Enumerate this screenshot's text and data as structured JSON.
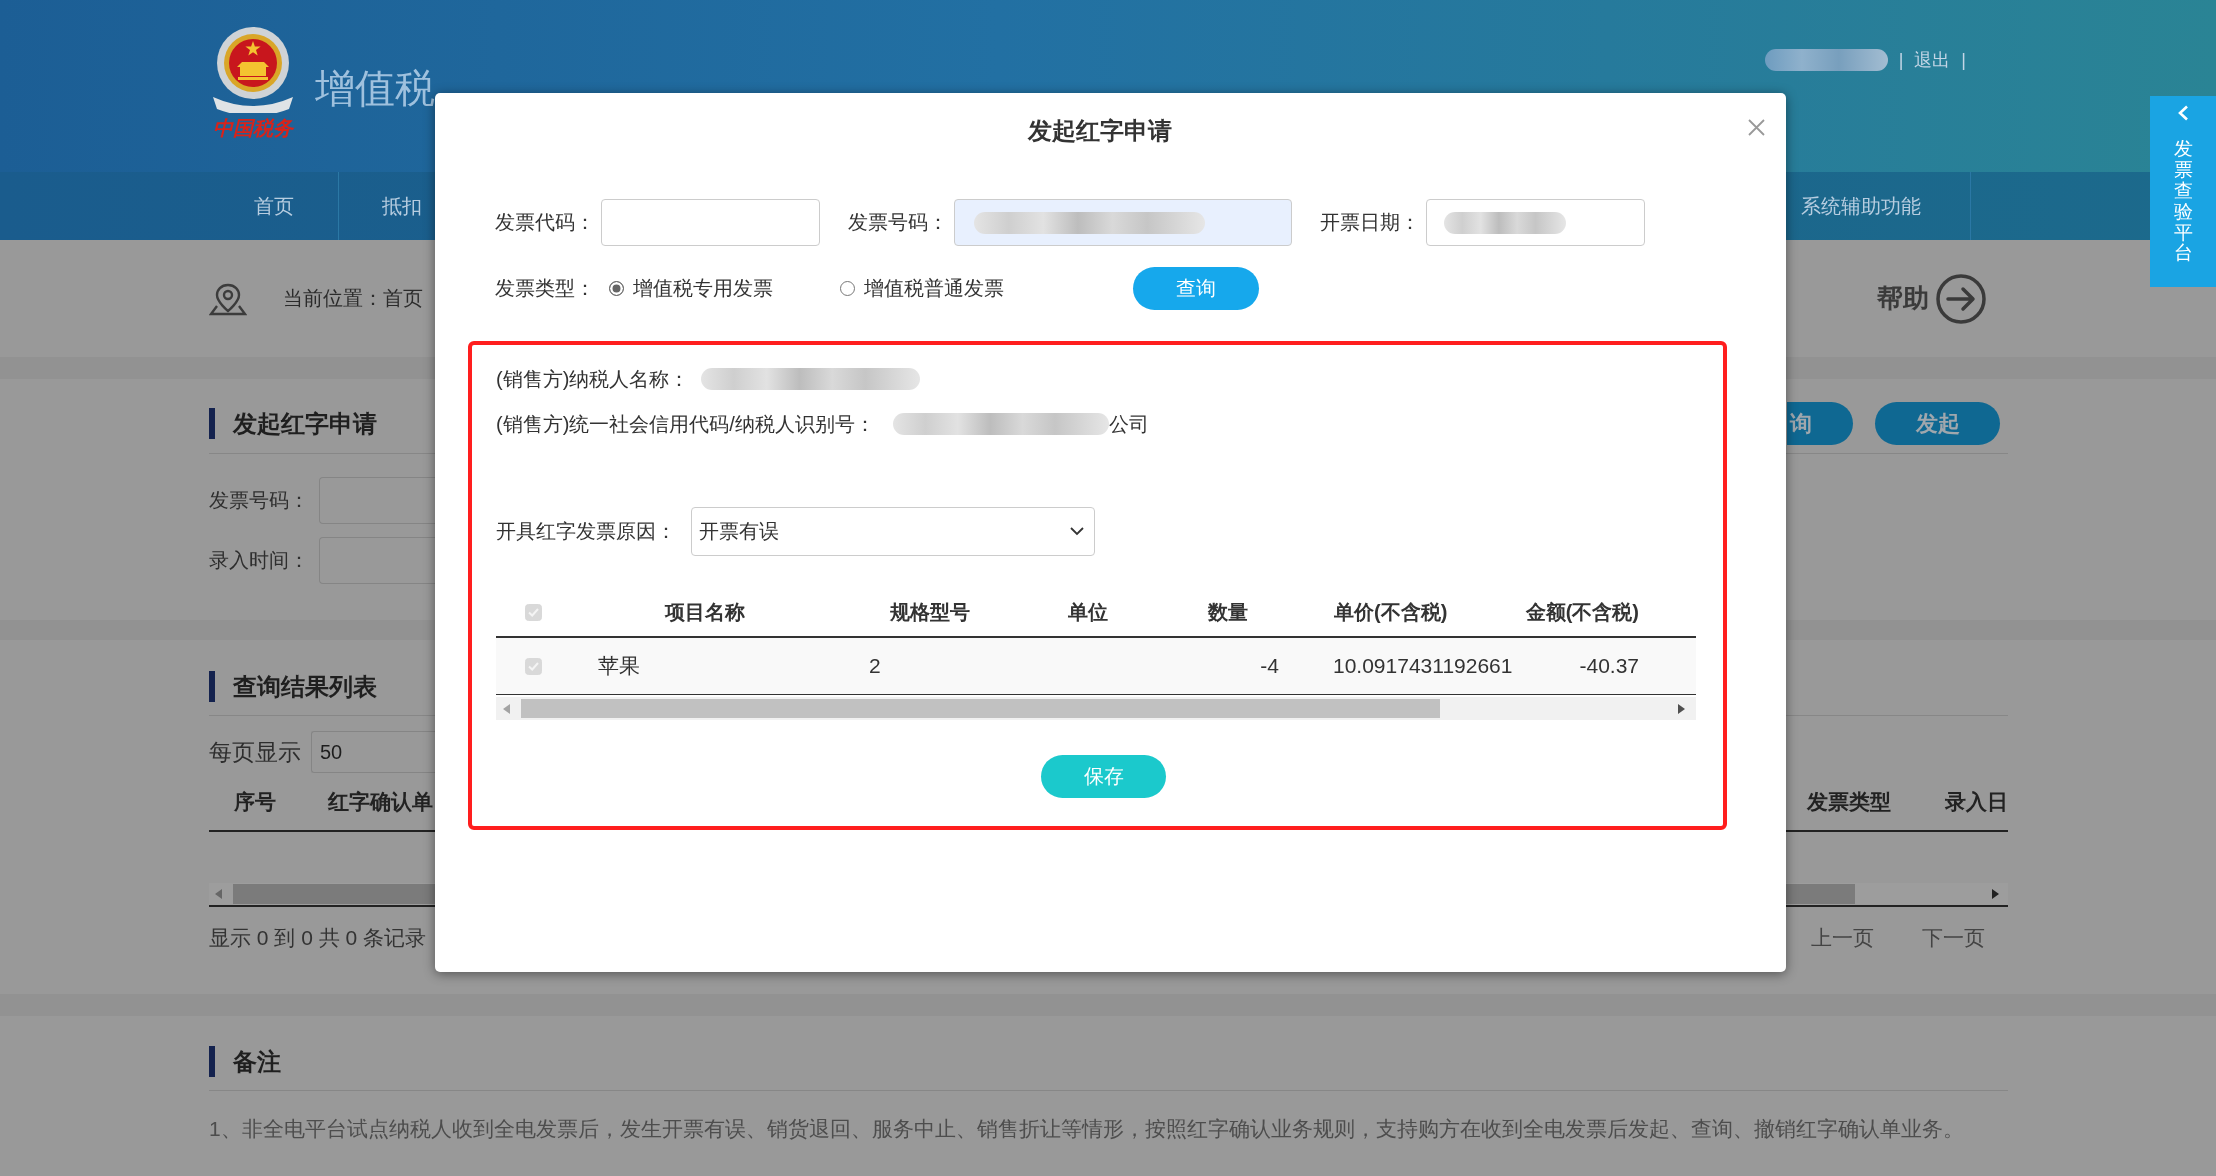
{
  "header": {
    "logo_text": "中国税务",
    "title": "增值税",
    "top_links": [
      {
        "kind": "redacted"
      },
      {
        "kind": "separator",
        "text": "|"
      },
      {
        "kind": "link",
        "text": "退出"
      },
      {
        "kind": "separator",
        "text": "|"
      }
    ]
  },
  "nav": {
    "items": [
      {
        "label": "首页"
      },
      {
        "label": "抵扣"
      },
      {
        "label": "系统辅助功能"
      }
    ]
  },
  "side_tab": {
    "label": "发票查验平台"
  },
  "breadcrumb": {
    "text": "当前位置：首页",
    "help": "帮助"
  },
  "apply_section": {
    "title": "发起红字申请",
    "buttons": [
      {
        "label": "询"
      },
      {
        "label": "发起"
      }
    ],
    "fields": [
      {
        "label": "发票号码："
      },
      {
        "label": "录入时间："
      }
    ]
  },
  "results_section": {
    "title": "查询结果列表",
    "page_size_label": "每页显示",
    "page_size": "50",
    "columns": [
      {
        "label": "序号"
      },
      {
        "label": "红字确认单"
      },
      {
        "label": "发票类型"
      },
      {
        "label": "录入日"
      }
    ],
    "summary": "显示 0 到 0 共 0 条记录",
    "pager": [
      {
        "label": "上一页"
      },
      {
        "label": "下一页"
      }
    ]
  },
  "notes_section": {
    "title": "备注",
    "items": [
      "1、非全电平台试点纳税人收到全电发票后，发生开票有误、销货退回、服务中止、销售折让等情形，按照红字确认业务规则，支持购方在收到全电发票后发起、查询、撤销红字确认单业务。"
    ]
  },
  "dialog": {
    "title": "发起红字申请",
    "query_fields": [
      {
        "label": "发票代码：",
        "redacted": false,
        "autofilled": false
      },
      {
        "label": "发票号码：",
        "redacted": true,
        "autofilled": true
      },
      {
        "label": "开票日期：",
        "redacted": true,
        "autofilled": false
      }
    ],
    "invoice_type": {
      "label": "发票类型：",
      "options": [
        {
          "label": "增值税专用发票",
          "selected": true
        },
        {
          "label": "增值税普通发票",
          "selected": false
        }
      ]
    },
    "query_button": "查询",
    "highlight": {
      "seller_lines": [
        {
          "label": "(销售方)纳税人名称：",
          "parts": [
            {
              "kind": "redacted"
            }
          ]
        },
        {
          "label": "(销售方)统一社会信用代码/纳税人识别号：",
          "parts": [
            {
              "kind": "redacted"
            },
            {
              "kind": "text",
              "text": "公司"
            }
          ]
        }
      ],
      "reason": {
        "label": "开具红字发票原因：",
        "value": "开票有误"
      },
      "items_table": {
        "select_all": {
          "checked": true,
          "disabled": true
        },
        "columns": [
          "项目名称",
          "规格型号",
          "单位",
          "数量",
          "单价(不含税)",
          "金额(不含税)"
        ],
        "rows": [
          {
            "checked": true,
            "disabled": true,
            "cells": [
              "苹果",
              "2",
              null,
              "-4",
              "10.0917431192661",
              "-40.37"
            ]
          }
        ]
      },
      "save_button": "保存"
    }
  }
}
